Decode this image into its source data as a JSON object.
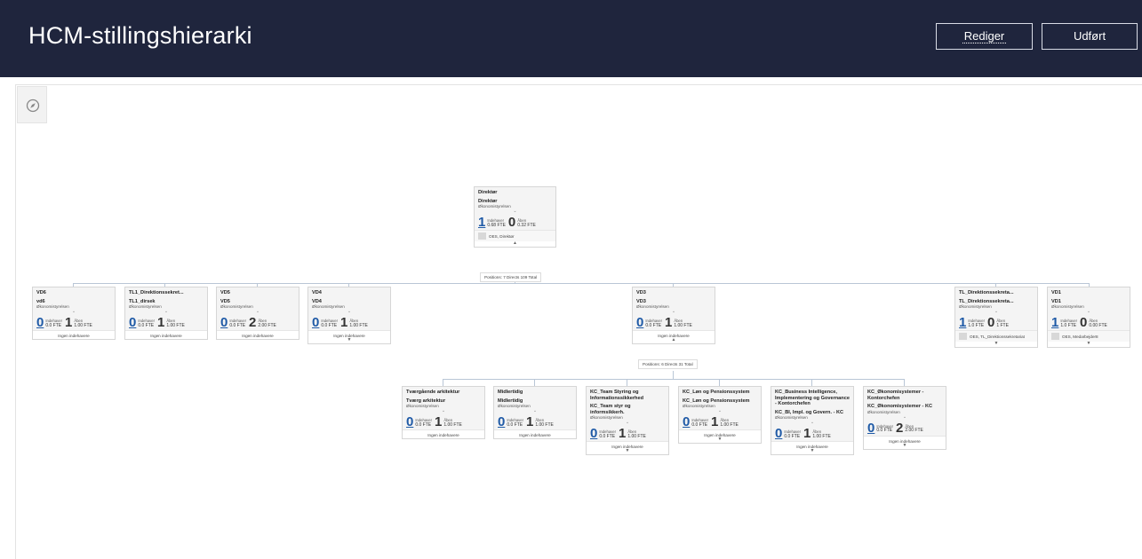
{
  "header": {
    "title": "HCM-stillingshierarki",
    "edit_label": "Rediger",
    "done_label": "Udført"
  },
  "toolbar": {
    "compass_icon": "compass-icon"
  },
  "labels": {
    "holder": "Indehaver",
    "open": "Åben",
    "no_holders": "Ingen indehavere"
  },
  "root": {
    "position": "Direktør",
    "job": "Direktør",
    "dept": "Økonomistyrelsen",
    "holders": "1",
    "holders_fte": "0.68 FTE",
    "open": "0",
    "open_fte": "0.32 FTE",
    "occupant": "OES, Direktør",
    "summary": "Positions: 7 Directs 109 Total"
  },
  "level1": [
    {
      "position": "VD6",
      "job": "vd6",
      "dept": "Økonomistyrelsen",
      "holders": "0",
      "holders_fte": "0.0 FTE",
      "open": "1",
      "open_fte": "1.00 FTE"
    },
    {
      "position": "TL1_Direktionssekret...",
      "job": "TL1_dirsek",
      "dept": "Økonomistyrelsen",
      "holders": "0",
      "holders_fte": "0.0 FTE",
      "open": "1",
      "open_fte": "1.00 FTE"
    },
    {
      "position": "VD5",
      "job": "VD5",
      "dept": "Økonomistyrelsen",
      "holders": "0",
      "holders_fte": "0.0 FTE",
      "open": "2",
      "open_fte": "2.00 FTE"
    },
    {
      "position": "VD4",
      "job": "VD4",
      "dept": "Økonomistyrelsen",
      "holders": "0",
      "holders_fte": "0.0 FTE",
      "open": "1",
      "open_fte": "1.00 FTE"
    },
    {
      "position": "VD3",
      "job": "VD3",
      "dept": "Økonomistyrelsen",
      "holders": "0",
      "holders_fte": "0.0 FTE",
      "open": "1",
      "open_fte": "1.00 FTE",
      "summary": "Positions: 6 Directs 31 Total"
    },
    {
      "position": "TL_Direktionssekreta...",
      "job": "TL_Direktionssekreta...",
      "dept": "Økonomistyrelsen",
      "holders": "1",
      "holders_fte": "1.0 FTE",
      "open": "0",
      "open_fte": "1 FTE",
      "occupant": "OES, TL_Direktionssekretariat"
    },
    {
      "position": "VD1",
      "job": "VD1",
      "dept": "Økonomistyrelsen",
      "holders": "1",
      "holders_fte": "1.0 FTE",
      "open": "0",
      "open_fte": "0.00 FTE",
      "occupant": "OES, Medarbejder8"
    }
  ],
  "level2": [
    {
      "position": "Tværgående arkitektur",
      "job": "Tværg arkitektur",
      "dept": "Økonomistyrelsen",
      "holders": "0",
      "holders_fte": "0.0 FTE",
      "open": "1",
      "open_fte": "1.00 FTE"
    },
    {
      "position": "Midlertidig",
      "job": "Midlertidig",
      "dept": "Økonomistyrelsen",
      "holders": "0",
      "holders_fte": "0.0 FTE",
      "open": "1",
      "open_fte": "1.00 FTE"
    },
    {
      "position": "KC_Team Styring og Informationssikkerhed",
      "job": "KC_Team styr og informsikkerh.",
      "dept": "Økonomistyrelsen",
      "holders": "0",
      "holders_fte": "0.0 FTE",
      "open": "1",
      "open_fte": "1.00 FTE"
    },
    {
      "position": "KC_Løn og Pensionssystem",
      "job": "KC_Løn og Pensionssystem",
      "dept": "Økonomistyrelsen",
      "holders": "0",
      "holders_fte": "0.0 FTE",
      "open": "1",
      "open_fte": "1.00 FTE"
    },
    {
      "position": "KC_Business Intelligence, Implementering og Governance - Kontorchefen",
      "job": "KC_BI, Impl. og Govern. - KC",
      "dept": "Økonomistyrelsen",
      "holders": "0",
      "holders_fte": "0.0 FTE",
      "open": "1",
      "open_fte": "1.00 FTE"
    },
    {
      "position": "KC_Økonomisystemer - Kontorchefen",
      "job": "KC_Økonomisystemer - KC",
      "dept": "Økonomistyrelsen",
      "holders": "0",
      "holders_fte": "0.0 FTE",
      "open": "2",
      "open_fte": "2.00 FTE"
    }
  ]
}
